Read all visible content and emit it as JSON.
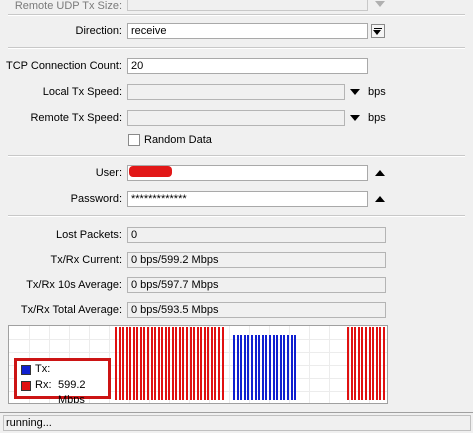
{
  "form": {
    "remote_udp_tx_size": {
      "label": "Remote UDP Tx Size:",
      "value": ""
    },
    "direction": {
      "label": "Direction:",
      "value": "receive"
    },
    "tcp_connection_count": {
      "label": "TCP Connection Count:",
      "value": "20"
    },
    "local_tx_speed": {
      "label": "Local Tx Speed:",
      "value": "",
      "unit": "bps"
    },
    "remote_tx_speed": {
      "label": "Remote Tx Speed:",
      "value": "",
      "unit": "bps"
    },
    "random_data": {
      "label": "Random Data",
      "checked": false
    },
    "user": {
      "label": "User:",
      "value": ""
    },
    "password": {
      "label": "Password:",
      "value": "*************"
    }
  },
  "stats": {
    "lost_packets": {
      "label": "Lost Packets:",
      "value": "0"
    },
    "txrx_current": {
      "label": "Tx/Rx Current:",
      "value": "0 bps/599.2 Mbps"
    },
    "txrx_10s_average": {
      "label": "Tx/Rx 10s Average:",
      "value": "0 bps/597.7 Mbps"
    },
    "txrx_total_average": {
      "label": "Tx/Rx Total Average:",
      "value": "0 bps/593.5 Mbps"
    }
  },
  "graph": {
    "legend": {
      "tx_label": "Tx:",
      "rx_label": "Rx:",
      "rx_value": "599.2 Mbps",
      "tx_color": "#1020d0",
      "rx_color": "#e01010"
    },
    "bar_series": "rx,rx,rx,rx,rx,rx,rx,rx,rx,rx,rx,rx,rx,rx,rx,rx,rx,rx,rx,rx,rx,rx,rx,rx,rx,rx,rx,rx,rx,rx,rx,tx,tx,tx,tx,tx,tx,tx,tx,tx,tx,tx,tx,tx,tx,tx,tx,tx,tx,rx,rx,rx,rx,rx,rx,rx,rx,rx,rx,rx"
  },
  "status": {
    "text": "running..."
  }
}
